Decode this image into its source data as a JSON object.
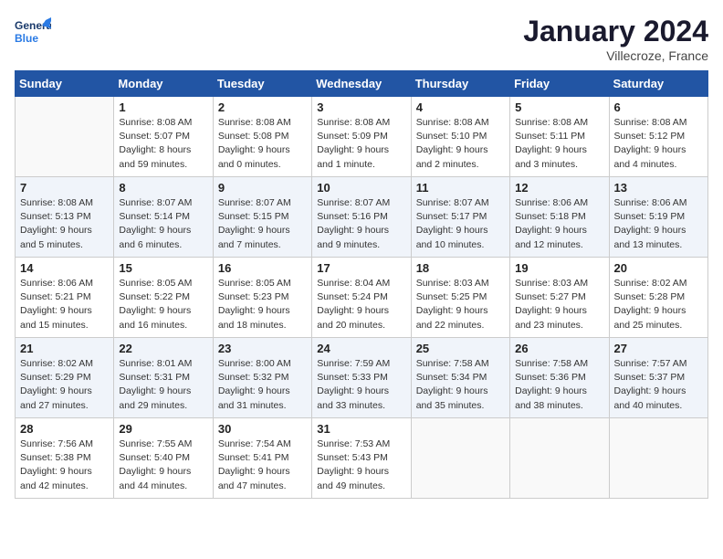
{
  "logo": {
    "line1": "General",
    "line2": "Blue"
  },
  "title": "January 2024",
  "subtitle": "Villecroze, France",
  "days_of_week": [
    "Sunday",
    "Monday",
    "Tuesday",
    "Wednesday",
    "Thursday",
    "Friday",
    "Saturday"
  ],
  "weeks": [
    [
      {
        "day": "",
        "info": ""
      },
      {
        "day": "1",
        "info": "Sunrise: 8:08 AM\nSunset: 5:07 PM\nDaylight: 8 hours\nand 59 minutes."
      },
      {
        "day": "2",
        "info": "Sunrise: 8:08 AM\nSunset: 5:08 PM\nDaylight: 9 hours\nand 0 minutes."
      },
      {
        "day": "3",
        "info": "Sunrise: 8:08 AM\nSunset: 5:09 PM\nDaylight: 9 hours\nand 1 minute."
      },
      {
        "day": "4",
        "info": "Sunrise: 8:08 AM\nSunset: 5:10 PM\nDaylight: 9 hours\nand 2 minutes."
      },
      {
        "day": "5",
        "info": "Sunrise: 8:08 AM\nSunset: 5:11 PM\nDaylight: 9 hours\nand 3 minutes."
      },
      {
        "day": "6",
        "info": "Sunrise: 8:08 AM\nSunset: 5:12 PM\nDaylight: 9 hours\nand 4 minutes."
      }
    ],
    [
      {
        "day": "7",
        "info": "Sunrise: 8:08 AM\nSunset: 5:13 PM\nDaylight: 9 hours\nand 5 minutes."
      },
      {
        "day": "8",
        "info": "Sunrise: 8:07 AM\nSunset: 5:14 PM\nDaylight: 9 hours\nand 6 minutes."
      },
      {
        "day": "9",
        "info": "Sunrise: 8:07 AM\nSunset: 5:15 PM\nDaylight: 9 hours\nand 7 minutes."
      },
      {
        "day": "10",
        "info": "Sunrise: 8:07 AM\nSunset: 5:16 PM\nDaylight: 9 hours\nand 9 minutes."
      },
      {
        "day": "11",
        "info": "Sunrise: 8:07 AM\nSunset: 5:17 PM\nDaylight: 9 hours\nand 10 minutes."
      },
      {
        "day": "12",
        "info": "Sunrise: 8:06 AM\nSunset: 5:18 PM\nDaylight: 9 hours\nand 12 minutes."
      },
      {
        "day": "13",
        "info": "Sunrise: 8:06 AM\nSunset: 5:19 PM\nDaylight: 9 hours\nand 13 minutes."
      }
    ],
    [
      {
        "day": "14",
        "info": "Sunrise: 8:06 AM\nSunset: 5:21 PM\nDaylight: 9 hours\nand 15 minutes."
      },
      {
        "day": "15",
        "info": "Sunrise: 8:05 AM\nSunset: 5:22 PM\nDaylight: 9 hours\nand 16 minutes."
      },
      {
        "day": "16",
        "info": "Sunrise: 8:05 AM\nSunset: 5:23 PM\nDaylight: 9 hours\nand 18 minutes."
      },
      {
        "day": "17",
        "info": "Sunrise: 8:04 AM\nSunset: 5:24 PM\nDaylight: 9 hours\nand 20 minutes."
      },
      {
        "day": "18",
        "info": "Sunrise: 8:03 AM\nSunset: 5:25 PM\nDaylight: 9 hours\nand 22 minutes."
      },
      {
        "day": "19",
        "info": "Sunrise: 8:03 AM\nSunset: 5:27 PM\nDaylight: 9 hours\nand 23 minutes."
      },
      {
        "day": "20",
        "info": "Sunrise: 8:02 AM\nSunset: 5:28 PM\nDaylight: 9 hours\nand 25 minutes."
      }
    ],
    [
      {
        "day": "21",
        "info": "Sunrise: 8:02 AM\nSunset: 5:29 PM\nDaylight: 9 hours\nand 27 minutes."
      },
      {
        "day": "22",
        "info": "Sunrise: 8:01 AM\nSunset: 5:31 PM\nDaylight: 9 hours\nand 29 minutes."
      },
      {
        "day": "23",
        "info": "Sunrise: 8:00 AM\nSunset: 5:32 PM\nDaylight: 9 hours\nand 31 minutes."
      },
      {
        "day": "24",
        "info": "Sunrise: 7:59 AM\nSunset: 5:33 PM\nDaylight: 9 hours\nand 33 minutes."
      },
      {
        "day": "25",
        "info": "Sunrise: 7:58 AM\nSunset: 5:34 PM\nDaylight: 9 hours\nand 35 minutes."
      },
      {
        "day": "26",
        "info": "Sunrise: 7:58 AM\nSunset: 5:36 PM\nDaylight: 9 hours\nand 38 minutes."
      },
      {
        "day": "27",
        "info": "Sunrise: 7:57 AM\nSunset: 5:37 PM\nDaylight: 9 hours\nand 40 minutes."
      }
    ],
    [
      {
        "day": "28",
        "info": "Sunrise: 7:56 AM\nSunset: 5:38 PM\nDaylight: 9 hours\nand 42 minutes."
      },
      {
        "day": "29",
        "info": "Sunrise: 7:55 AM\nSunset: 5:40 PM\nDaylight: 9 hours\nand 44 minutes."
      },
      {
        "day": "30",
        "info": "Sunrise: 7:54 AM\nSunset: 5:41 PM\nDaylight: 9 hours\nand 47 minutes."
      },
      {
        "day": "31",
        "info": "Sunrise: 7:53 AM\nSunset: 5:43 PM\nDaylight: 9 hours\nand 49 minutes."
      },
      {
        "day": "",
        "info": ""
      },
      {
        "day": "",
        "info": ""
      },
      {
        "day": "",
        "info": ""
      }
    ]
  ]
}
